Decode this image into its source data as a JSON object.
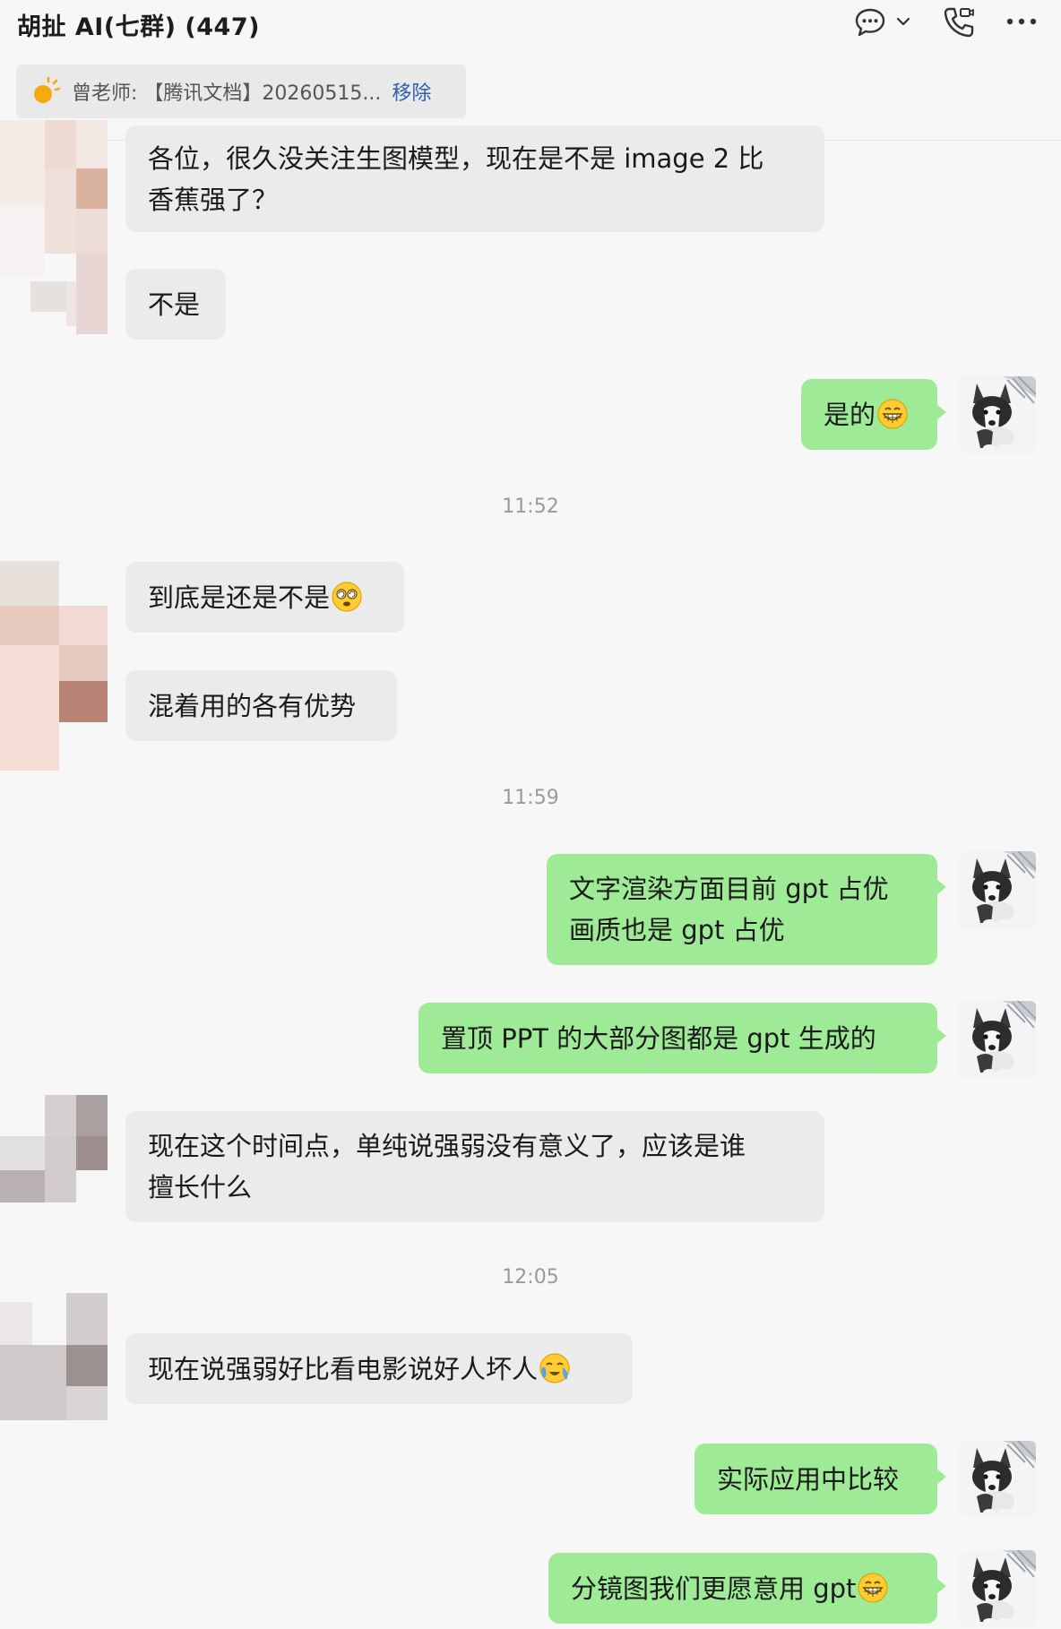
{
  "header": {
    "title": "胡扯 AI(七群) (447)"
  },
  "pinned": {
    "text": "曾老师: 【腾讯文档】20260515...",
    "remove_label": "移除"
  },
  "timestamps": [
    "11:52",
    "11:59",
    "12:05"
  ],
  "messages": [
    {
      "side": "in",
      "lines": [
        "各位，很久没关注生图模型，现在是不是 image 2 比",
        "香蕉强了？"
      ]
    },
    {
      "side": "in",
      "lines": [
        "不是"
      ]
    },
    {
      "side": "out",
      "lines": [
        "是的"
      ],
      "emoji": "grin-emoji"
    },
    {
      "side": "in",
      "lines": [
        "到底是还是不是"
      ],
      "emoji": "dizzy-emoji"
    },
    {
      "side": "in",
      "lines": [
        "混着用的各有优势"
      ]
    },
    {
      "side": "out",
      "lines": [
        "文字渲染方面目前 gpt 占优",
        "画质也是 gpt 占优"
      ]
    },
    {
      "side": "out",
      "lines": [
        "置顶 PPT 的大部分图都是 gpt 生成的"
      ]
    },
    {
      "side": "in",
      "lines": [
        "现在这个时间点，单纯说强弱没有意义了，应该是谁",
        "擅长什么"
      ]
    },
    {
      "side": "in",
      "lines": [
        "现在说强弱好比看电影说好人坏人"
      ],
      "emoji": "crying-emoji"
    },
    {
      "side": "out",
      "lines": [
        "实际应用中比较"
      ]
    },
    {
      "side": "out",
      "lines": [
        "分镜图我们更愿意用 gpt"
      ],
      "emoji": "grin-emoji"
    }
  ]
}
